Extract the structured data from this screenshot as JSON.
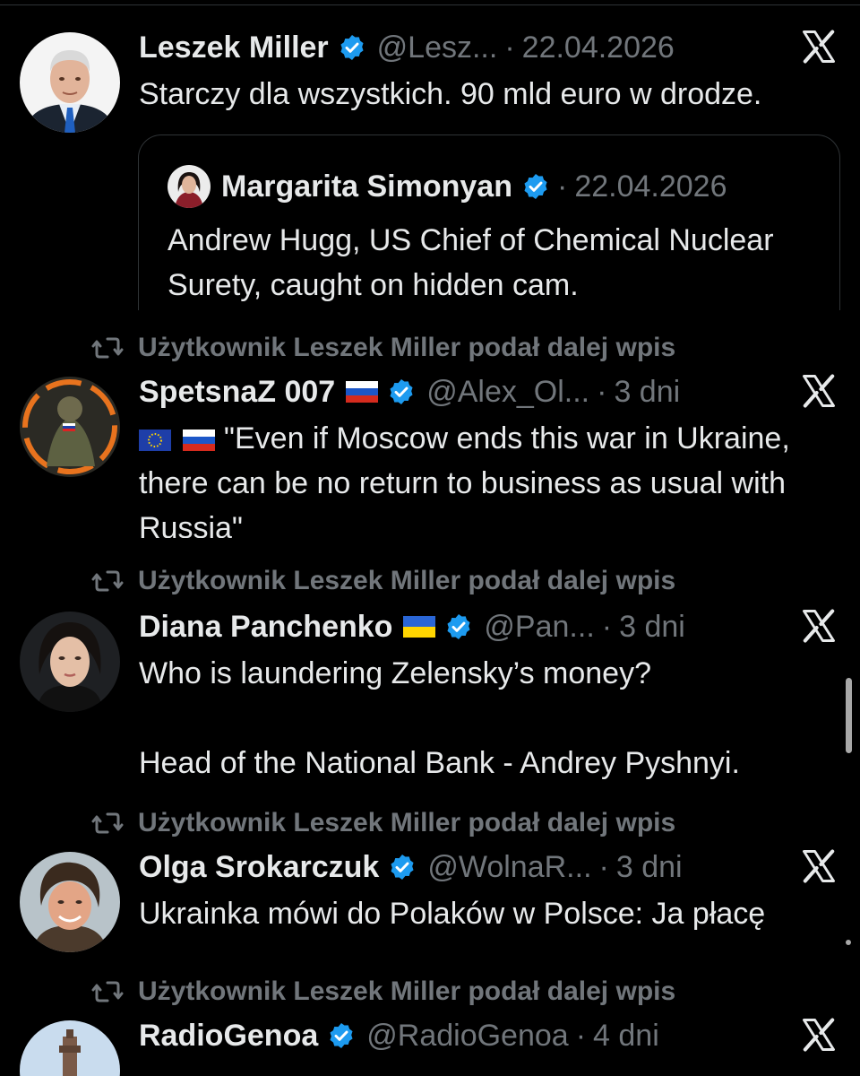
{
  "posts": [
    {
      "author": "Leszek Miller",
      "handle": "@Lesz...",
      "date": "22.04.2026",
      "text": "Starczy dla wszystkich. 90 mld euro w drodze.",
      "avatar_icon": "portrait-man-gray-hair",
      "quote": {
        "author": "Margarita Simonyan",
        "date": "22.04.2026",
        "text": "Andrew Hugg, US Chief of Chemical Nuclear Surety, caught on hidden cam."
      }
    },
    {
      "repost_label": "Użytkownik Leszek Miller podał dalej wpis",
      "author": "SpetsnaZ 007",
      "flag": "russia-flag",
      "handle": "@Alex_Ol...",
      "date": "3 dni",
      "text_flags": [
        "eu-flag",
        "russia-flag"
      ],
      "text": "\"Even if Moscow ends this war in Ukraine, there can be no return to business as usual with Russia\"",
      "avatar_icon": "soldier-avatar"
    },
    {
      "repost_label": "Użytkownik Leszek Miller podał dalej wpis",
      "author": "Diana Panchenko",
      "flag": "ukraine-flag",
      "handle": "@Pan...",
      "date": "3 dni",
      "text_line1": "Who is laundering Zelensky’s money?",
      "text_line2": "Head of the National Bank - Andrey Pyshnyi.",
      "avatar_icon": "portrait-woman-dark-hair"
    },
    {
      "repost_label": "Użytkownik Leszek Miller podał dalej wpis",
      "author": "Olga Srokarczuk",
      "handle": "@WolnaR...",
      "date": "3 dni",
      "text": "Ukrainka mówi do Polaków w Polsce: Ja płacę",
      "avatar_icon": "portrait-woman-short-hair"
    },
    {
      "repost_label": "Użytkownik Leszek Miller podał dalej wpis",
      "author": "RadioGenoa",
      "handle": "@RadioGenoa",
      "date": "4 dni",
      "avatar_icon": "lighthouse-avatar"
    }
  ],
  "colors": {
    "background": "#000000",
    "text": "#e7e9ea",
    "muted": "#71767b",
    "verified": "#1d9bf0",
    "border": "#2f3336"
  }
}
